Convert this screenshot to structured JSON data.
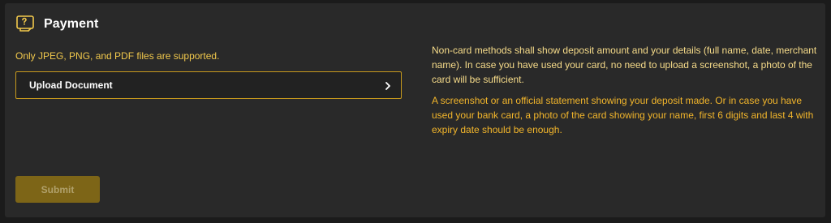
{
  "colors": {
    "accent": "#f2c94c",
    "border": "#c89a1d",
    "panel_bg": "#292929",
    "submit_bg": "#7d6517"
  },
  "header": {
    "icon": "payment-icon",
    "title": "Payment"
  },
  "upload": {
    "supported_text": "Only JPEG, PNG, and PDF files are supported.",
    "button_label": "Upload Document",
    "chevron_icon": "chevron-right-icon"
  },
  "notes": {
    "non_card": "Non-card methods shall show deposit amount and your details (full name, date, merchant name). In case you have used your card, no need to upload a screenshot, a photo of the card will be sufficient.",
    "statement": "A screenshot or an official statement showing your deposit made. Or in case you have used your bank card, a photo of the card showing your name, first 6 digits and last 4 with expiry date should be enough."
  },
  "submit": {
    "label": "Submit",
    "disabled": true
  }
}
